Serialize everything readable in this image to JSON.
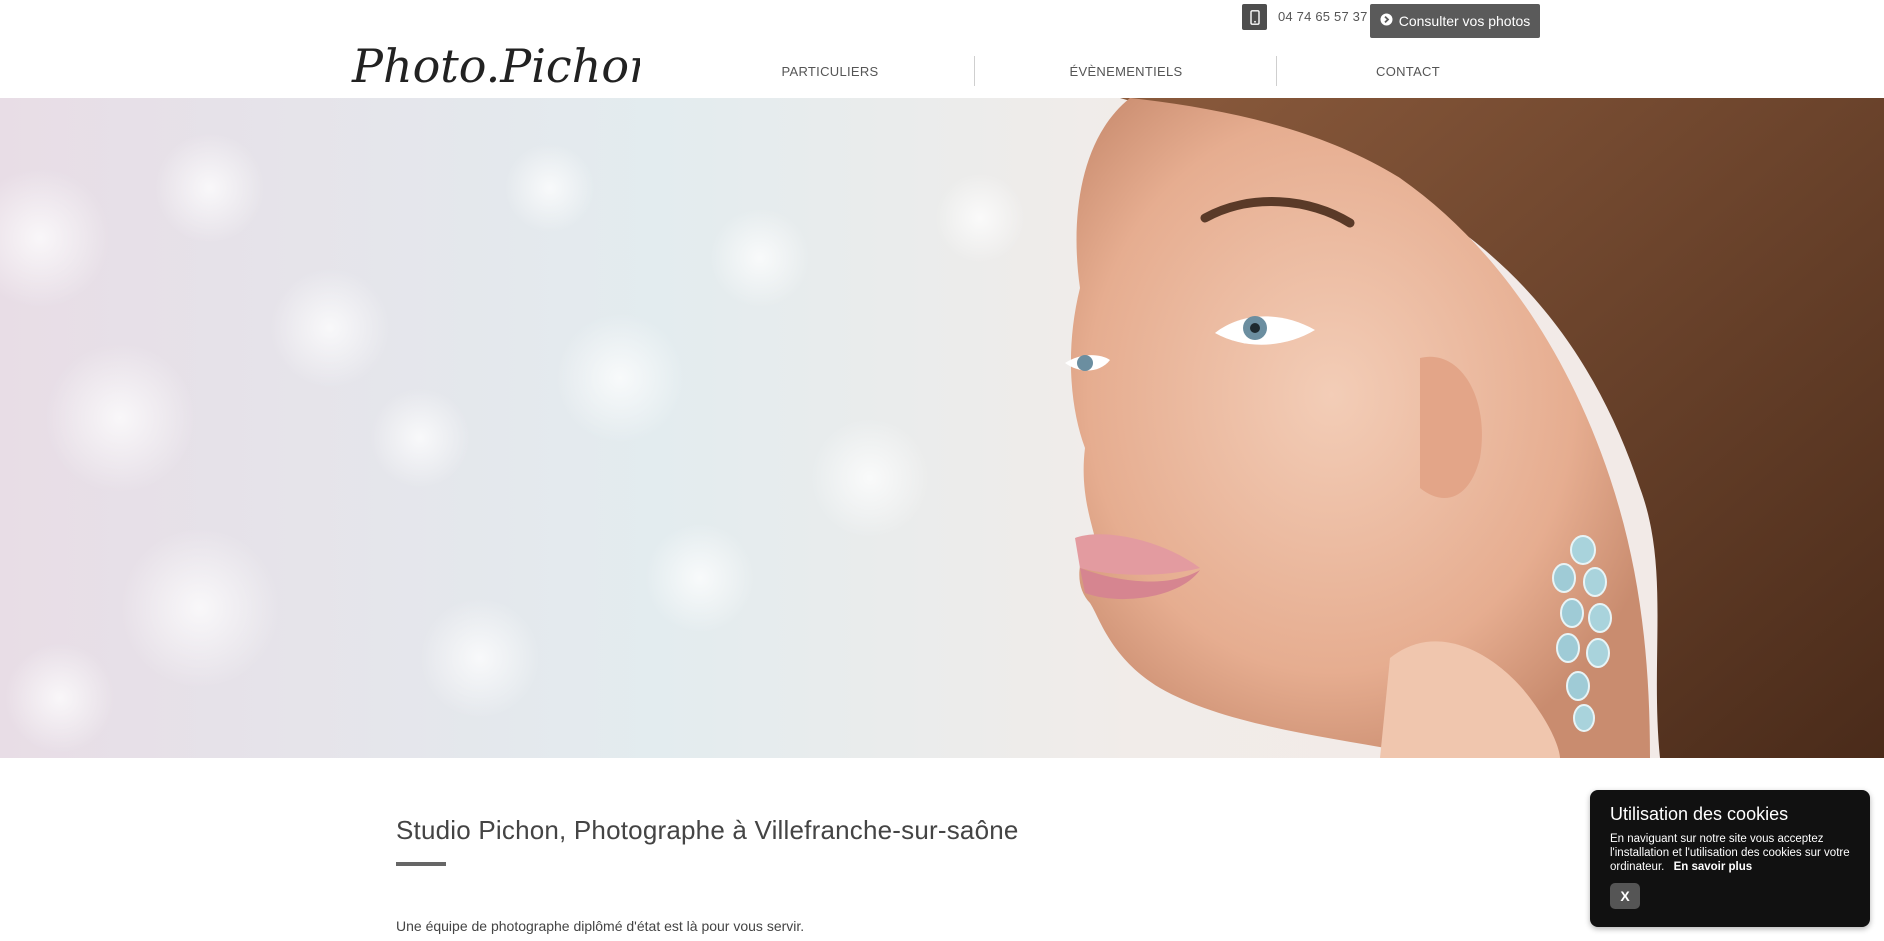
{
  "header": {
    "brand": "Photo.Pichon",
    "phone": "04 74 65 57 37",
    "consult_label": "Consulter vos photos",
    "nav": [
      "PARTICULIERS",
      "ÉVÈNEMENTIELS",
      "CONTACT"
    ]
  },
  "hero": {
    "image_subject": "woman-portrait-with-earring"
  },
  "main": {
    "title": "Studio Pichon, Photographe à Villefranche-sur-saône",
    "intro": "Une équipe de photographe diplômé d'état est là pour vous servir."
  },
  "cookie": {
    "title": "Utilisation des cookies",
    "text": "En naviguant sur notre site vous acceptez l'installation et l'utilisation des cookies sur votre ordinateur.",
    "more_label": "En savoir plus",
    "close_label": "X"
  },
  "colors": {
    "button_bg": "#5a5a5a",
    "cookie_bg": "#111111",
    "accent_rule": "#666666"
  },
  "icons": {
    "phone": "mobile-phone-icon",
    "consult": "chevron-circle-right-icon"
  }
}
